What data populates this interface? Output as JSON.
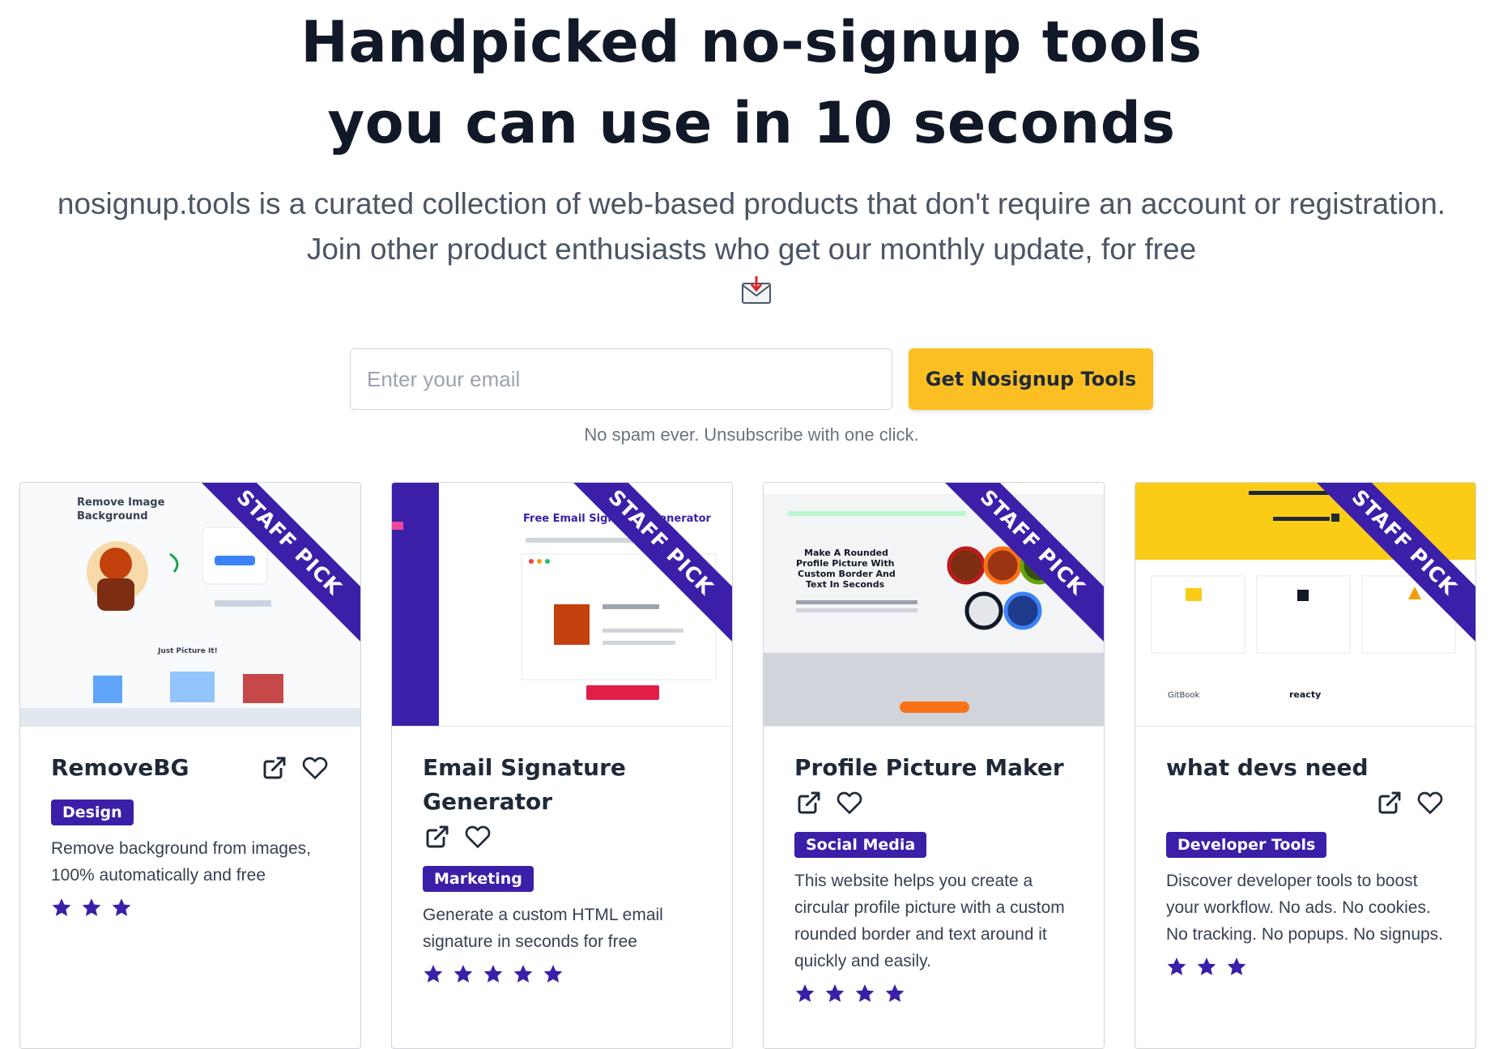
{
  "hero": {
    "title_line1": "Handpicked no-signup tools",
    "title_line2": "you can use in 10 seconds",
    "subtitle_line1": "nosignup.tools is a curated collection of web-based products that don't require an account or registration.",
    "subtitle_line2": "Join other product enthusiasts who get our monthly update, for free",
    "mail_icon": "incoming-envelope-icon"
  },
  "signup": {
    "email_placeholder": "Enter your email",
    "button_label": "Get Nosignup Tools",
    "note": "No spam ever. Unsubscribe with one click."
  },
  "colors": {
    "accent": "#3b1fa8",
    "cta": "#fbbf24",
    "text": "#111827"
  },
  "cards": [
    {
      "ribbon": "STAFF PICK",
      "title": "RemoveBG",
      "tag": "Design",
      "description": "Remove background from images, 100% automatically and free",
      "rating": 3,
      "screenshot_text": [
        "Remove Image",
        "Background",
        "Just Picture It!"
      ]
    },
    {
      "ribbon": "STAFF PICK",
      "title": "Email Signature Generator",
      "tag": "Marketing",
      "description": "Generate a custom HTML email signature in seconds for free",
      "rating": 5,
      "screenshot_text": [
        "Free Email Signature Generator"
      ]
    },
    {
      "ribbon": "STAFF PICK",
      "title": "Profile Picture Maker",
      "tag": "Social Media",
      "description": "This website helps you create a circular profile picture with a custom rounded border and text around it quickly and easily.",
      "rating": 4,
      "screenshot_text": [
        "Make A Rounded",
        "Profile Picture With",
        "Custom Border And",
        "Text In Seconds"
      ]
    },
    {
      "ribbon": "STAFF PICK",
      "title": "what devs need",
      "tag": "Developer Tools",
      "description": "Discover developer tools to boost your workflow. No ads. No cookies. No tracking. No popups. No signups.",
      "rating": 3,
      "screenshot_text": [
        "GitBook",
        "reacty"
      ]
    }
  ]
}
